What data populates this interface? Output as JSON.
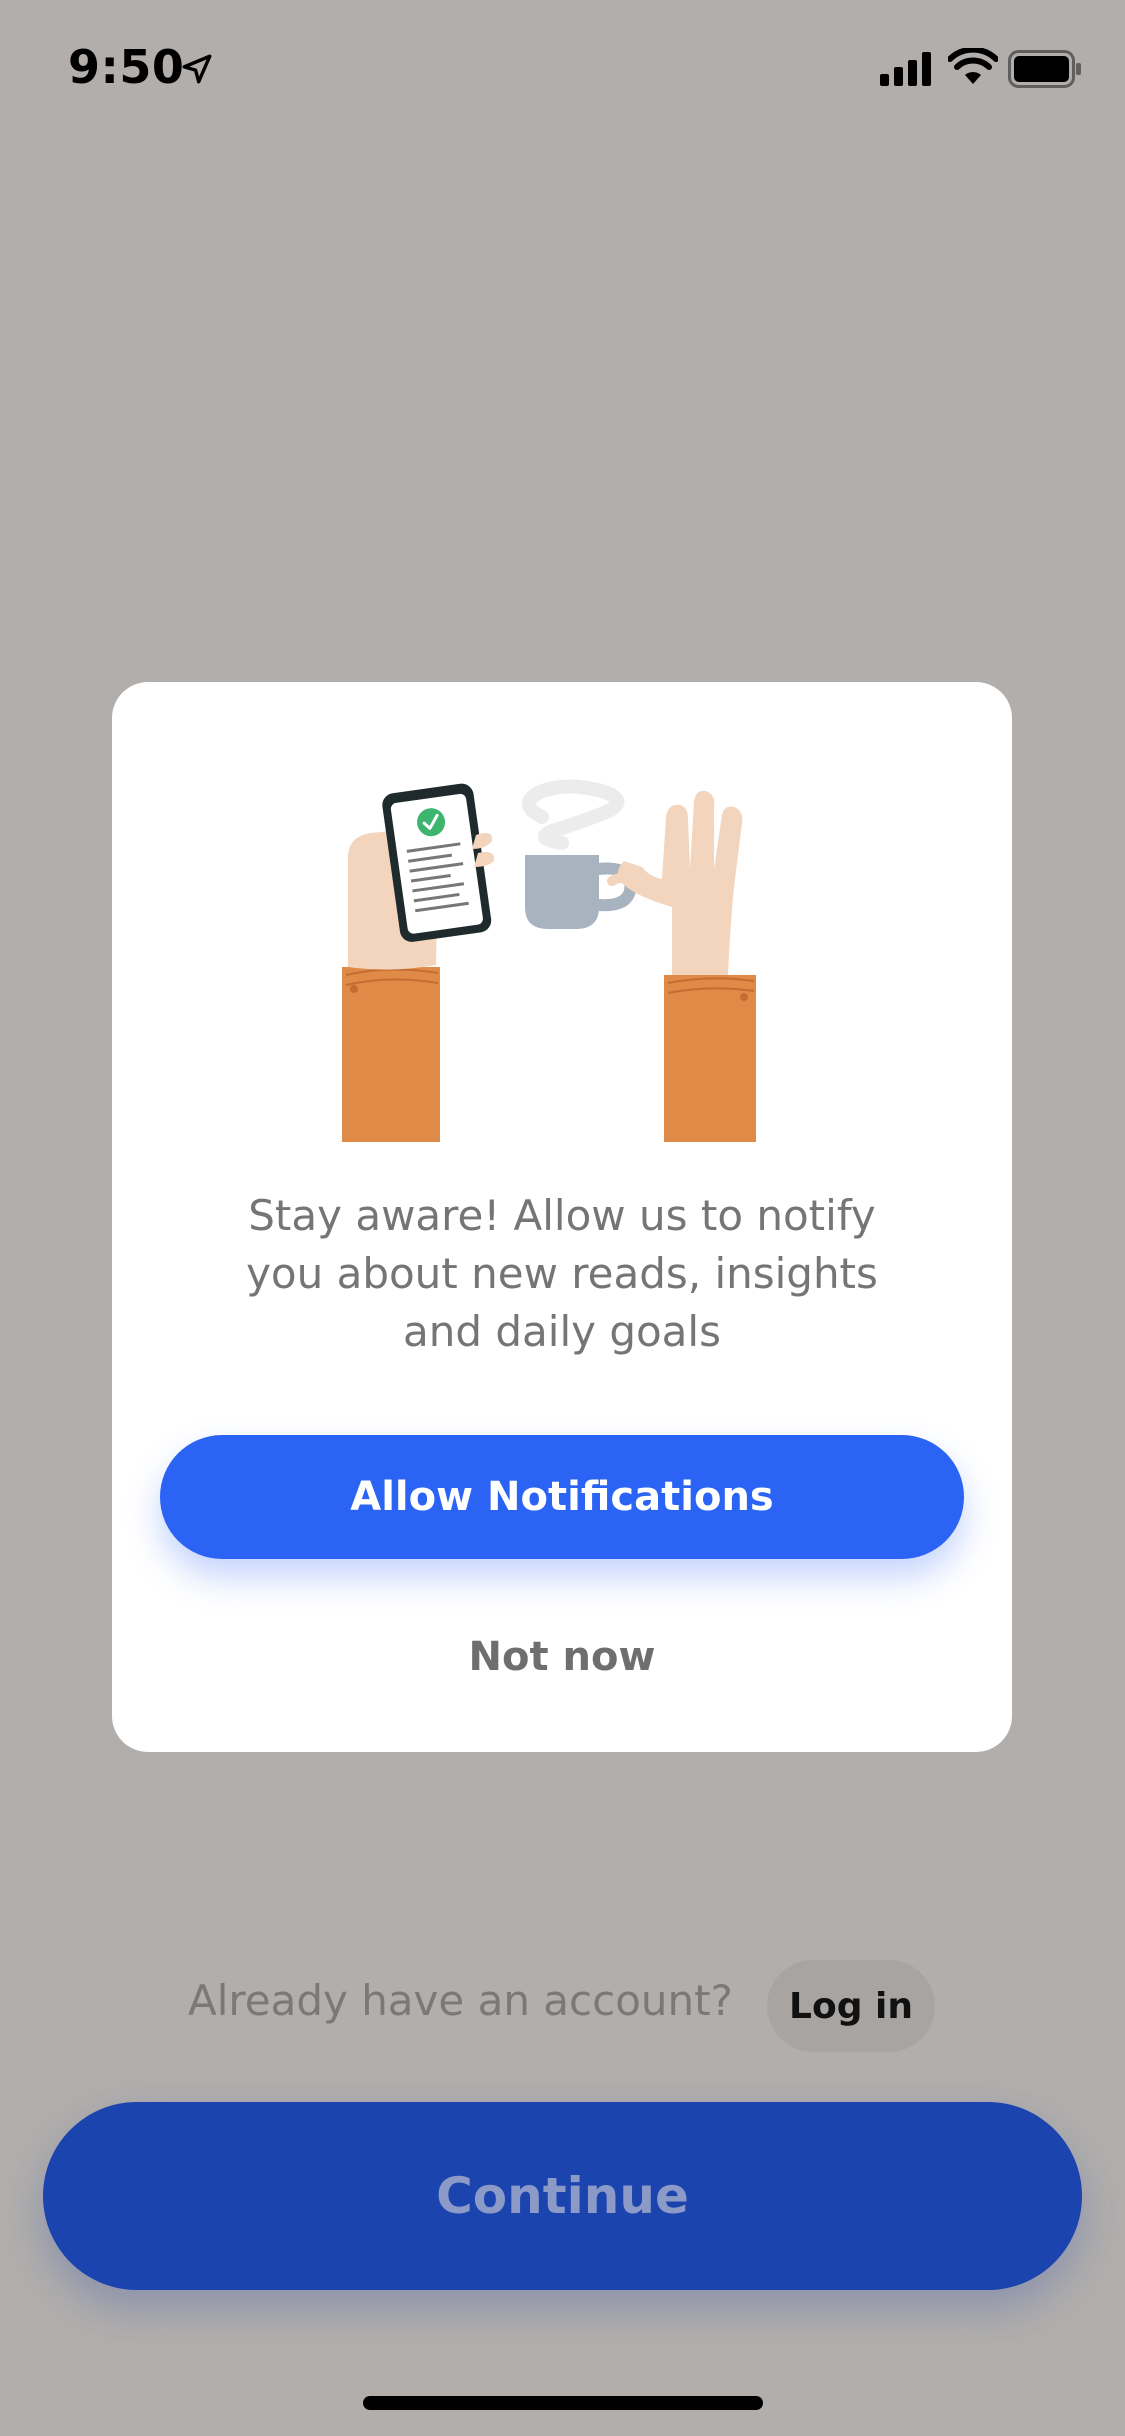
{
  "status_bar": {
    "time": "9:50",
    "icons": [
      "location-arrow-icon",
      "cellular-signal-icon",
      "wifi-icon",
      "battery-icon"
    ]
  },
  "modal": {
    "illustration": "hands-phone-coffee-illustration",
    "message": "Stay aware! Allow us to notify you about new reads, insights and daily goals",
    "allow_label": "Allow Notifications",
    "not_now_label": "Not now"
  },
  "background": {
    "account_prompt": "Already have an account?",
    "login_label": "Log in",
    "continue_label": "Continue"
  },
  "colors": {
    "accent": "#2b64f4",
    "overlay": "#b1aeac",
    "sleeve": "#e08a47",
    "skin": "#f3d5bd",
    "mug": "#a7b4bf",
    "check": "#3db56f"
  }
}
